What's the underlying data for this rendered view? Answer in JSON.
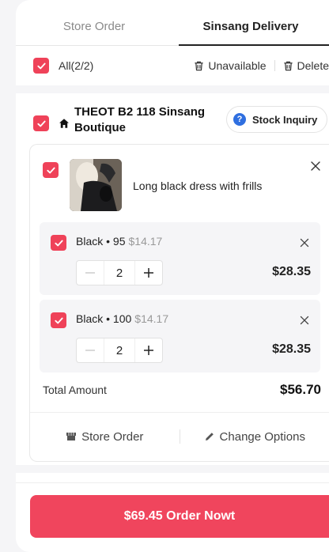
{
  "tabs": [
    {
      "label": "Store Order",
      "active": false
    },
    {
      "label": "Sinsang Delivery",
      "active": true
    }
  ],
  "select_all": {
    "label": "All(2/2)",
    "checked": true
  },
  "toolbar": {
    "unavailable_label": "Unavailable",
    "delete_label": "Delete"
  },
  "store": {
    "name": "THEOT B2 118 Sinsang Boutique",
    "inquiry_label": "Stock Inquiry",
    "checked": true
  },
  "item": {
    "title": "Long black dress with frills",
    "checked": true,
    "variants": [
      {
        "label": "Black • 95",
        "unit_price": "$14.17",
        "qty": "2",
        "total": "$28.35",
        "checked": true
      },
      {
        "label": "Black • 100",
        "unit_price": "$14.17",
        "qty": "2",
        "total": "$28.35",
        "checked": true
      }
    ],
    "total_label": "Total Amount",
    "total_value": "$56.70",
    "store_order_label": "Store Order",
    "change_options_label": "Change Options"
  },
  "order_button": {
    "label": "$69.45 Order Nowt"
  },
  "colors": {
    "accent": "#f0455d",
    "checkbox": "#ef4259",
    "info": "#2f6fe0"
  }
}
